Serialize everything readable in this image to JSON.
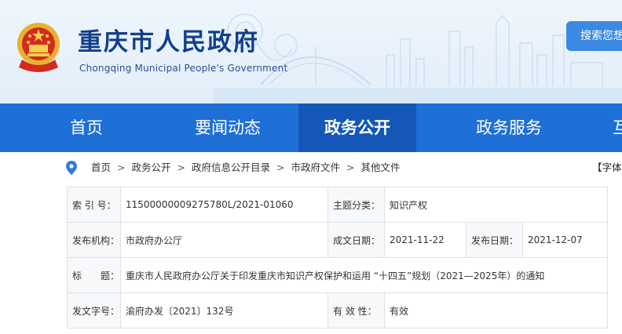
{
  "header": {
    "site_title": "重庆市人民政府",
    "site_subtitle": "Chongqing Municipal People's Government",
    "search_label": "搜索您想"
  },
  "nav": {
    "items": [
      {
        "label": "首页"
      },
      {
        "label": "要闻动态"
      },
      {
        "label": "政务公开",
        "active": true
      },
      {
        "label": "政务服务"
      },
      {
        "label": "互"
      }
    ]
  },
  "breadcrumb": {
    "items": [
      "首页",
      "政务公开",
      "政府信息公开目录",
      "市政府文件",
      "其他文件"
    ],
    "separator": ">",
    "font_size_label": "【字体"
  },
  "info": {
    "index_label": "索 引 号：",
    "index_value": "11500000009275780L/2021-01060",
    "category_label": "主题分类：",
    "category_value": "知识产权",
    "org_label": "发布机构：",
    "org_value": "市政府办公厅",
    "created_label": "成文日期：",
    "created_value": "2021-11-22",
    "published_label": "发布日期：",
    "published_value": "2021-12-07",
    "title_label": "标　　题：",
    "title_value": "重庆市人民政府办公厅关于印发重庆市知识产权保护和运用 “十四五”规划（2021—2025年）的通知",
    "doc_no_label": "发文字号：",
    "doc_no_value": "渝府办发〔2021〕132号",
    "validity_label": "有 效 性：",
    "validity_value": "有效"
  },
  "colors": {
    "nav_blue": "#1e6fd6",
    "nav_active": "#1457b8",
    "title_blue": "#123f8c",
    "search_blue": "#3b89e3"
  }
}
